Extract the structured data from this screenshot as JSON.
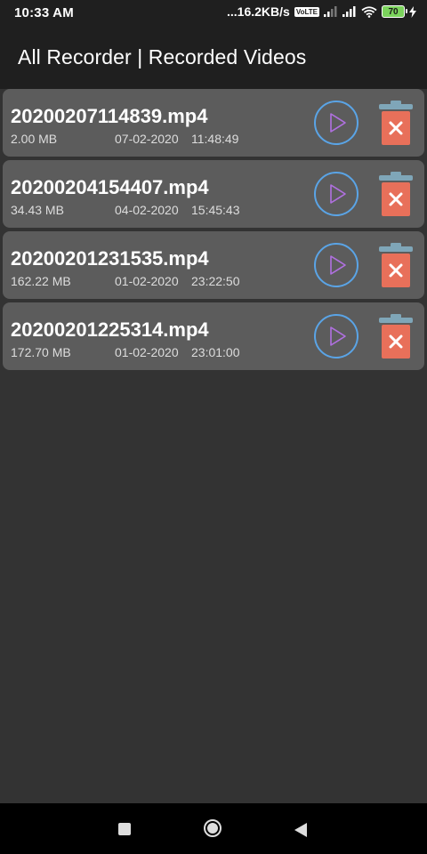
{
  "status_bar": {
    "time": "10:33 AM",
    "network_speed": "...16.2KB/s",
    "volte_label": "VoLTE",
    "battery": "70",
    "icons": [
      "signal-icon",
      "signal-icon",
      "wifi-icon",
      "battery-icon",
      "charging-icon"
    ]
  },
  "app_bar": {
    "title": "All Recorder | Recorded Videos"
  },
  "recordings": [
    {
      "filename": "20200207114839.mp4",
      "size": "2.00 MB",
      "date": "07-02-2020",
      "time": "11:48:49"
    },
    {
      "filename": "20200204154407.mp4",
      "size": "34.43 MB",
      "date": "04-02-2020",
      "time": "15:45:43"
    },
    {
      "filename": "20200201231535.mp4",
      "size": "162.22 MB",
      "date": "01-02-2020",
      "time": "23:22:50"
    },
    {
      "filename": "20200201225314.mp4",
      "size": "172.70 MB",
      "date": "01-02-2020",
      "time": "23:01:00"
    }
  ],
  "colors": {
    "background": "#333333",
    "bar": "#1f1f1f",
    "card": "#5c5c5c",
    "play_ring_start": "#5aa4e6",
    "play_ring_end": "#e060c0",
    "play_triangle": "#b070e0",
    "delete_red": "#e8705a",
    "delete_lid": "#7fa6b8"
  },
  "nav_bar": {
    "icons": [
      "recents-square-icon",
      "home-circle-icon",
      "back-triangle-icon"
    ]
  }
}
